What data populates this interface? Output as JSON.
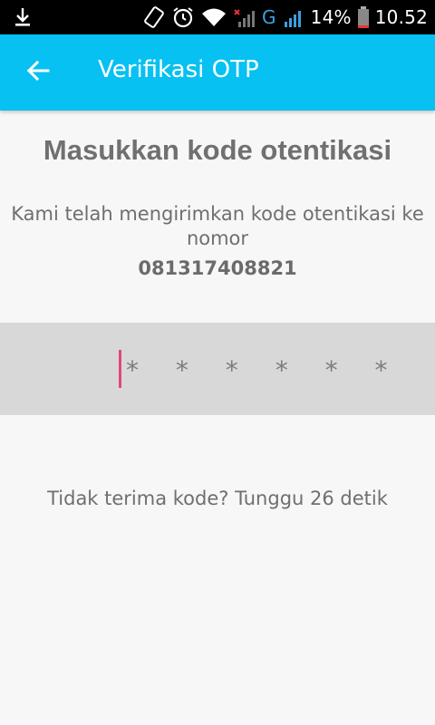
{
  "status_bar": {
    "battery": "14%",
    "time": "10.52",
    "network": "G",
    "icons": [
      "download-icon",
      "rotate-icon",
      "alarm-icon",
      "wifi-icon",
      "signal-icon",
      "signal-icon",
      "battery-icon"
    ]
  },
  "app_bar": {
    "title": "Verifikasi OTP",
    "back_icon": "arrow-left-icon",
    "background_color": "#06c1f1"
  },
  "content": {
    "heading": "Masukkan kode otentikasi",
    "description_line1": "Kami telah mengirimkan kode otentikasi ke",
    "description_line2": "nomor",
    "phone": "081317408821"
  },
  "otp": {
    "display": "* * * * * *",
    "cursor_color": "#e0487a"
  },
  "resend": {
    "text": "Tidak terima kode? Tunggu 26 detik"
  }
}
